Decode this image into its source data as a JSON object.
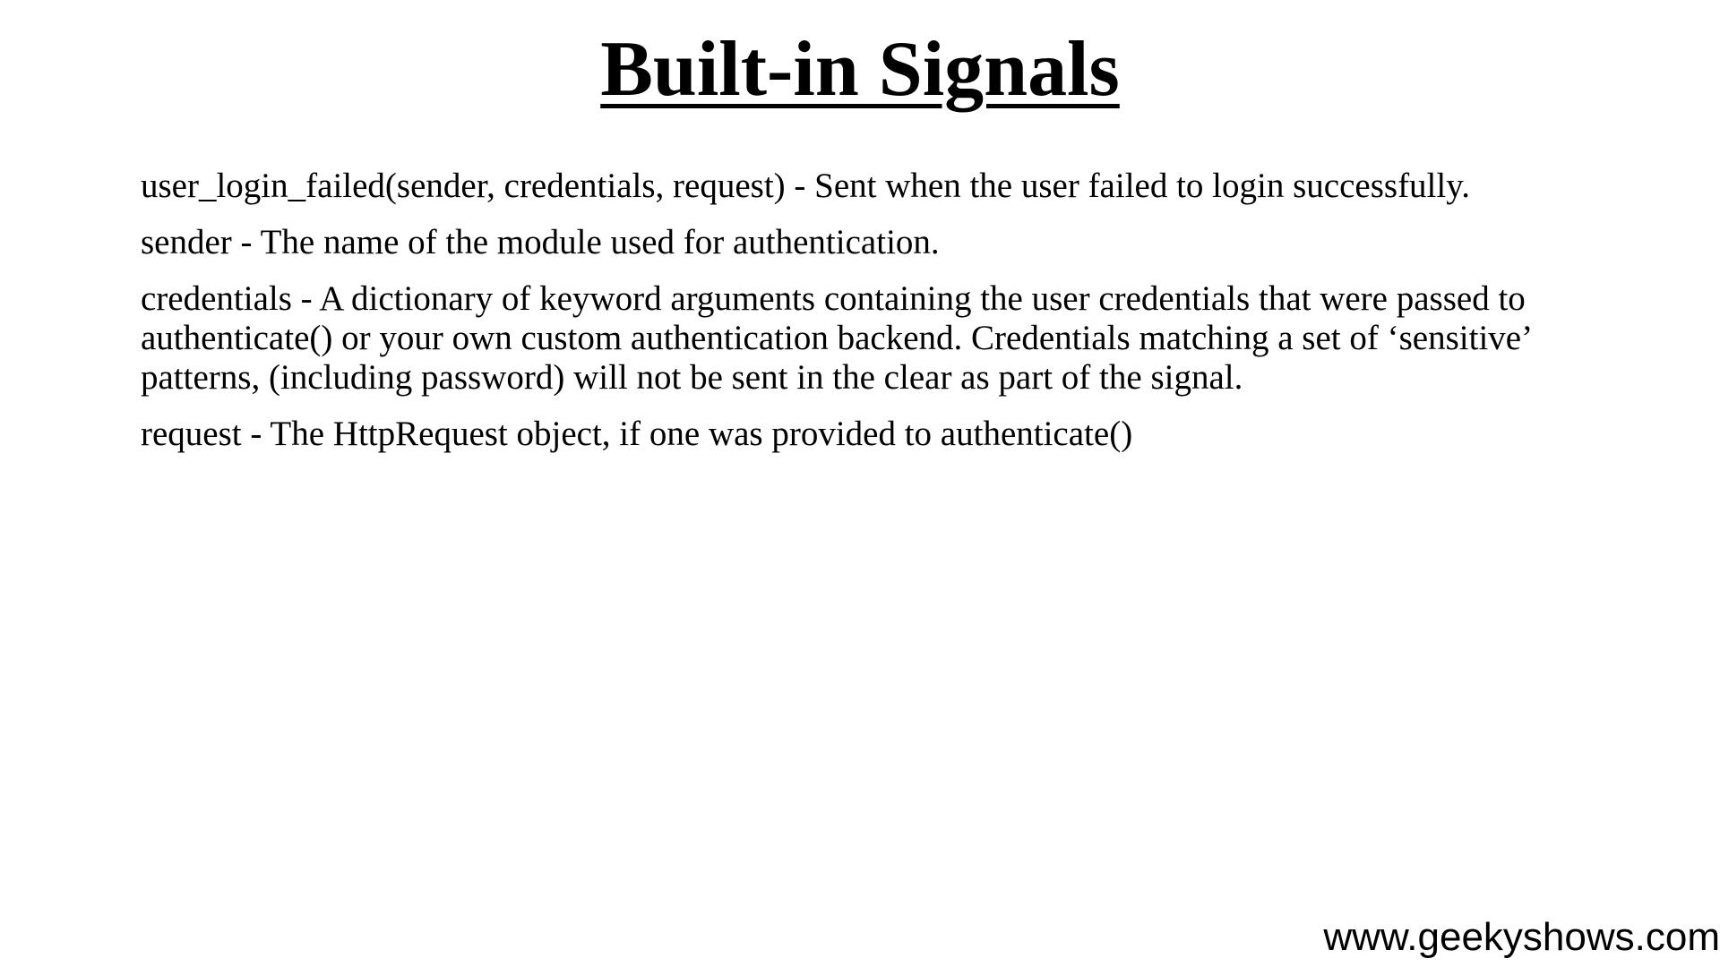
{
  "slide": {
    "title": "Built-in Signals",
    "paragraphs": [
      "user_login_failed(sender, credentials, request) - Sent when the user failed to login successfully.",
      "sender - The name of the module used for authentication.",
      "credentials - A dictionary of keyword arguments containing the user credentials that were passed to authenticate() or your own custom authentication backend. Credentials matching a set of ‘sensitive’ patterns, (including password) will not be sent in the clear as part of the signal.",
      "request - The HttpRequest object, if one was provided to authenticate()"
    ],
    "footer": "www.geekyshows.com"
  }
}
